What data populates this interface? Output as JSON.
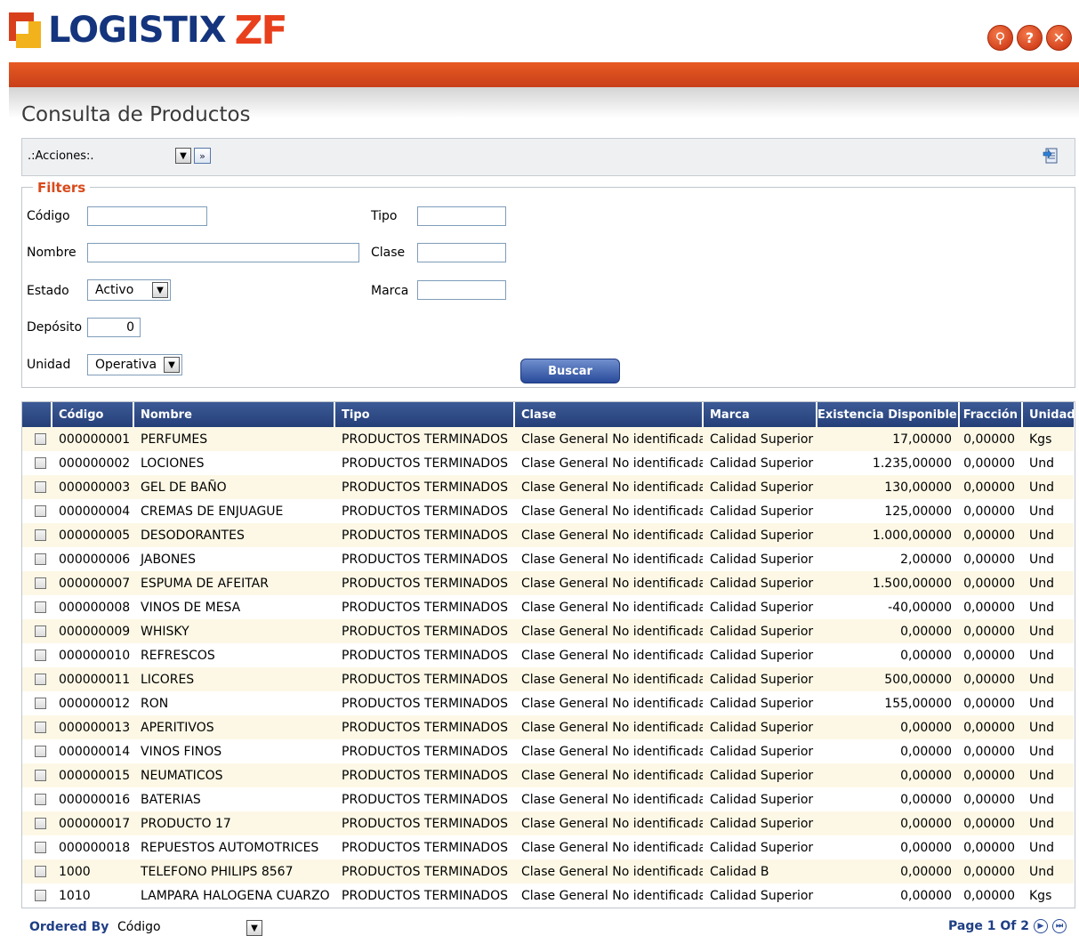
{
  "app": {
    "logo_main": "LOGISTIX",
    "logo_suffix": "ZF"
  },
  "header_icons": [
    {
      "name": "search-icon",
      "glyph": "⚲"
    },
    {
      "name": "help-icon",
      "glyph": "?"
    },
    {
      "name": "close-icon",
      "glyph": "✕"
    }
  ],
  "page": {
    "title": "Consulta de Productos"
  },
  "toolbar": {
    "actions_select": ".:Acciones:.",
    "go_glyph": "»"
  },
  "filters": {
    "legend": "Filters",
    "codigo": {
      "label": "Código",
      "value": ""
    },
    "nombre": {
      "label": "Nombre",
      "value": ""
    },
    "estado": {
      "label": "Estado",
      "value": "Activo"
    },
    "deposito": {
      "label": "Depósito",
      "value": "0"
    },
    "unidad": {
      "label": "Unidad",
      "value": "Operativa"
    },
    "tipo": {
      "label": "Tipo",
      "value": ""
    },
    "clase": {
      "label": "Clase",
      "value": ""
    },
    "marca": {
      "label": "Marca",
      "value": ""
    },
    "buscar_label": "Buscar"
  },
  "table": {
    "columns": [
      "Código",
      "Nombre",
      "Tipo",
      "Clase",
      "Marca",
      "Existencia Disponible",
      "Fracción",
      "Unidad"
    ],
    "rows": [
      {
        "codigo": "000000001",
        "nombre": "PERFUMES",
        "tipo": "PRODUCTOS TERMINADOS",
        "clase": "Clase General No identificada",
        "marca": "Calidad Superior",
        "existencia": "17,00000",
        "fraccion": "0,00000",
        "unidad": "Kgs"
      },
      {
        "codigo": "000000002",
        "nombre": "LOCIONES",
        "tipo": "PRODUCTOS TERMINADOS",
        "clase": "Clase General No identificada",
        "marca": "Calidad Superior",
        "existencia": "1.235,00000",
        "fraccion": "0,00000",
        "unidad": "Und"
      },
      {
        "codigo": "000000003",
        "nombre": "GEL DE BAÑO",
        "tipo": "PRODUCTOS TERMINADOS",
        "clase": "Clase General No identificada",
        "marca": "Calidad Superior",
        "existencia": "130,00000",
        "fraccion": "0,00000",
        "unidad": "Und"
      },
      {
        "codigo": "000000004",
        "nombre": "CREMAS DE ENJUAGUE",
        "tipo": "PRODUCTOS TERMINADOS",
        "clase": "Clase General No identificada",
        "marca": "Calidad Superior",
        "existencia": "125,00000",
        "fraccion": "0,00000",
        "unidad": "Und"
      },
      {
        "codigo": "000000005",
        "nombre": "DESODORANTES",
        "tipo": "PRODUCTOS TERMINADOS",
        "clase": "Clase General No identificada",
        "marca": "Calidad Superior",
        "existencia": "1.000,00000",
        "fraccion": "0,00000",
        "unidad": "Und"
      },
      {
        "codigo": "000000006",
        "nombre": "JABONES",
        "tipo": "PRODUCTOS TERMINADOS",
        "clase": "Clase General No identificada",
        "marca": "Calidad Superior",
        "existencia": "2,00000",
        "fraccion": "0,00000",
        "unidad": "Und"
      },
      {
        "codigo": "000000007",
        "nombre": "ESPUMA DE AFEITAR",
        "tipo": "PRODUCTOS TERMINADOS",
        "clase": "Clase General No identificada",
        "marca": "Calidad Superior",
        "existencia": "1.500,00000",
        "fraccion": "0,00000",
        "unidad": "Und"
      },
      {
        "codigo": "000000008",
        "nombre": "VINOS DE MESA",
        "tipo": "PRODUCTOS TERMINADOS",
        "clase": "Clase General No identificada",
        "marca": "Calidad Superior",
        "existencia": "-40,00000",
        "fraccion": "0,00000",
        "unidad": "Und"
      },
      {
        "codigo": "000000009",
        "nombre": "WHISKY",
        "tipo": "PRODUCTOS TERMINADOS",
        "clase": "Clase General No identificada",
        "marca": "Calidad Superior",
        "existencia": "0,00000",
        "fraccion": "0,00000",
        "unidad": "Und"
      },
      {
        "codigo": "000000010",
        "nombre": "REFRESCOS",
        "tipo": "PRODUCTOS TERMINADOS",
        "clase": "Clase General No identificada",
        "marca": "Calidad Superior",
        "existencia": "0,00000",
        "fraccion": "0,00000",
        "unidad": "Und"
      },
      {
        "codigo": "000000011",
        "nombre": "LICORES",
        "tipo": "PRODUCTOS TERMINADOS",
        "clase": "Clase General No identificada",
        "marca": "Calidad Superior",
        "existencia": "500,00000",
        "fraccion": "0,00000",
        "unidad": "Und"
      },
      {
        "codigo": "000000012",
        "nombre": "RON",
        "tipo": "PRODUCTOS TERMINADOS",
        "clase": "Clase General No identificada",
        "marca": "Calidad Superior",
        "existencia": "155,00000",
        "fraccion": "0,00000",
        "unidad": "Und"
      },
      {
        "codigo": "000000013",
        "nombre": "APERITIVOS",
        "tipo": "PRODUCTOS TERMINADOS",
        "clase": "Clase General No identificada",
        "marca": "Calidad Superior",
        "existencia": "0,00000",
        "fraccion": "0,00000",
        "unidad": "Und"
      },
      {
        "codigo": "000000014",
        "nombre": "VINOS FINOS",
        "tipo": "PRODUCTOS TERMINADOS",
        "clase": "Clase General No identificada",
        "marca": "Calidad Superior",
        "existencia": "0,00000",
        "fraccion": "0,00000",
        "unidad": "Und"
      },
      {
        "codigo": "000000015",
        "nombre": "NEUMATICOS",
        "tipo": "PRODUCTOS TERMINADOS",
        "clase": "Clase General No identificada",
        "marca": "Calidad Superior",
        "existencia": "0,00000",
        "fraccion": "0,00000",
        "unidad": "Und"
      },
      {
        "codigo": "000000016",
        "nombre": "BATERIAS",
        "tipo": "PRODUCTOS TERMINADOS",
        "clase": "Clase General No identificada",
        "marca": "Calidad Superior",
        "existencia": "0,00000",
        "fraccion": "0,00000",
        "unidad": "Und"
      },
      {
        "codigo": "000000017",
        "nombre": "PRODUCTO 17",
        "tipo": "PRODUCTOS TERMINADOS",
        "clase": "Clase General No identificada",
        "marca": "Calidad Superior",
        "existencia": "0,00000",
        "fraccion": "0,00000",
        "unidad": "Und"
      },
      {
        "codigo": "000000018",
        "nombre": "REPUESTOS AUTOMOTRICES",
        "tipo": "PRODUCTOS TERMINADOS",
        "clase": "Clase General No identificada",
        "marca": "Calidad Superior",
        "existencia": "0,00000",
        "fraccion": "0,00000",
        "unidad": "Und"
      },
      {
        "codigo": "1000",
        "nombre": "TELEFONO PHILIPS 8567",
        "tipo": "PRODUCTOS TERMINADOS",
        "clase": "Clase General No identificada",
        "marca": "Calidad B",
        "existencia": "0,00000",
        "fraccion": "0,00000",
        "unidad": "Und"
      },
      {
        "codigo": "1010",
        "nombre": "LAMPARA HALOGENA CUARZO",
        "tipo": "PRODUCTOS TERMINADOS",
        "clase": "Clase General No identificada",
        "marca": "Calidad Superior",
        "existencia": "0,00000",
        "fraccion": "0,00000",
        "unidad": "Kgs"
      }
    ]
  },
  "footer": {
    "ordered_by_label": "Ordered By",
    "ordered_by_value": "Código",
    "page_label": "Page 1 Of 2"
  },
  "colors": {
    "brand_blue": "#14357d",
    "brand_orange": "#e8401c",
    "header_blue": "#2c4784",
    "row_highlight": "#fdf8e6"
  }
}
